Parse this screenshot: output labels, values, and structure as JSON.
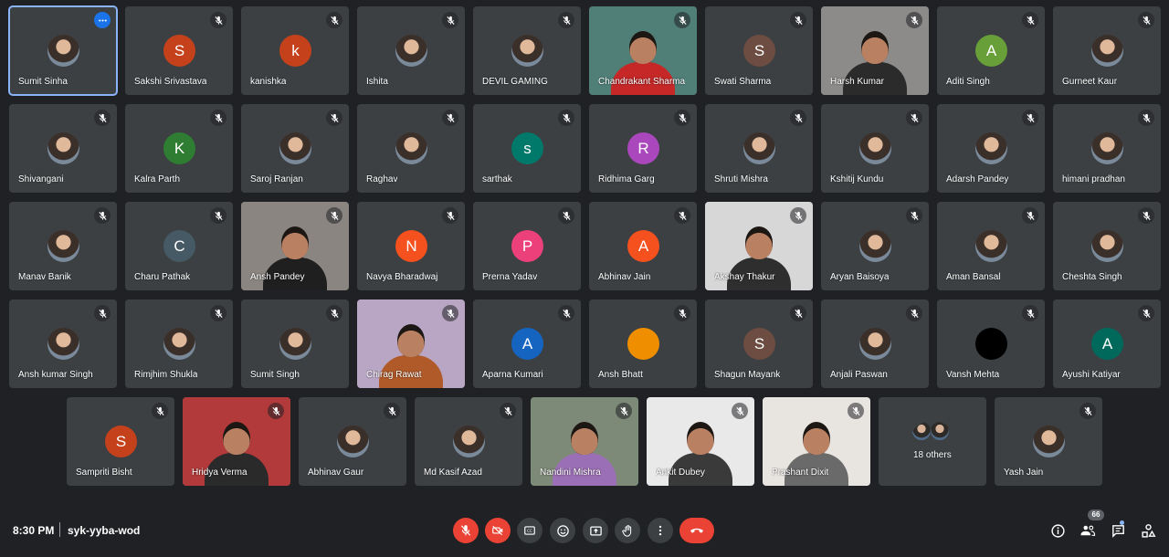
{
  "tiles": [
    {
      "name": "Sumit Sinha",
      "type": "photo",
      "active": true
    },
    {
      "name": "Sakshi Srivastava",
      "type": "letter",
      "letter": "S",
      "color": "#c5411b"
    },
    {
      "name": "kanishka",
      "type": "letter",
      "letter": "k",
      "color": "#c5411b"
    },
    {
      "name": "Ishita",
      "type": "photo"
    },
    {
      "name": "DEVIL GAMING",
      "type": "photo"
    },
    {
      "name": "Chandrakant Sharma",
      "type": "video",
      "bg": "#4f7f77",
      "shirt": "#c62828"
    },
    {
      "name": "Swati Sharma",
      "type": "letter",
      "letter": "S",
      "color": "#6d4c41"
    },
    {
      "name": "Harsh Kumar",
      "type": "video",
      "bg": "#8d8a8a",
      "shirt": "#2b2b2b"
    },
    {
      "name": "Aditi Singh",
      "type": "letter",
      "letter": "A",
      "color": "#689f38"
    },
    {
      "name": "Gurneet Kaur",
      "type": "photo"
    },
    {
      "name": "Shivangani",
      "type": "photo"
    },
    {
      "name": "Kalra Parth",
      "type": "letter",
      "letter": "K",
      "color": "#2e7d32"
    },
    {
      "name": "Saroj Ranjan",
      "type": "photo"
    },
    {
      "name": "Raghav",
      "type": "photo"
    },
    {
      "name": "sarthak",
      "type": "letter",
      "letter": "s",
      "color": "#00796b"
    },
    {
      "name": "Ridhima Garg",
      "type": "letter",
      "letter": "R",
      "color": "#ab47bc"
    },
    {
      "name": "Shruti Mishra",
      "type": "photo"
    },
    {
      "name": "Kshitij Kundu",
      "type": "photo"
    },
    {
      "name": "Adarsh Pandey",
      "type": "photo"
    },
    {
      "name": "himani pradhan",
      "type": "photo"
    },
    {
      "name": "Manav Banik",
      "type": "photo"
    },
    {
      "name": "Charu Pathak",
      "type": "letter",
      "letter": "C",
      "color": "#455a64"
    },
    {
      "name": "Ansh Pandey",
      "type": "video",
      "bg": "#8a8580",
      "shirt": "#1f1f1f"
    },
    {
      "name": "Navya Bharadwaj",
      "type": "letter",
      "letter": "N",
      "color": "#f4511e"
    },
    {
      "name": "Prerna Yadav",
      "type": "letter",
      "letter": "P",
      "color": "#ec407a"
    },
    {
      "name": "Abhinav Jain",
      "type": "letter",
      "letter": "A",
      "color": "#f4511e"
    },
    {
      "name": "Akshay Thakur",
      "type": "video",
      "bg": "#d7d7d7",
      "shirt": "#2e2e2e"
    },
    {
      "name": "Aryan Baisoya",
      "type": "photo"
    },
    {
      "name": "Aman Bansal",
      "type": "photo"
    },
    {
      "name": "Cheshta Singh",
      "type": "photo"
    },
    {
      "name": "Ansh kumar Singh",
      "type": "photo"
    },
    {
      "name": "Rimjhim Shukla",
      "type": "photo"
    },
    {
      "name": "Sumit Singh",
      "type": "photo"
    },
    {
      "name": "Chirag Rawat",
      "type": "video",
      "bg": "#b8a6c4",
      "shirt": "#b05a2a"
    },
    {
      "name": "Aparna Kumari",
      "type": "letter",
      "letter": "A",
      "color": "#1565c0"
    },
    {
      "name": "Ansh Bhatt",
      "type": "letter",
      "letter": "",
      "color": "#ef8f00"
    },
    {
      "name": "Shagun Mayank",
      "type": "letter",
      "letter": "S",
      "color": "#6d4c41"
    },
    {
      "name": "Anjali Paswan",
      "type": "photo"
    },
    {
      "name": "Vansh Mehta",
      "type": "letter",
      "letter": "",
      "color": "#000000"
    },
    {
      "name": "Ayushi Katiyar",
      "type": "letter",
      "letter": "A",
      "color": "#00695c"
    },
    {
      "name": "Sampriti Bisht",
      "type": "letter",
      "letter": "S",
      "color": "#c5411b"
    },
    {
      "name": "Hridya Verma",
      "type": "video",
      "bg": "#b23a3a",
      "shirt": "#2a2a2a"
    },
    {
      "name": "Abhinav Gaur",
      "type": "photo"
    },
    {
      "name": "Md Kasif Azad",
      "type": "photo"
    },
    {
      "name": "Nandini Mishra",
      "type": "video",
      "bg": "#7d8a78",
      "shirt": "#9b6fb5"
    },
    {
      "name": "Ankit Dubey",
      "type": "video",
      "bg": "#e9e9e9",
      "shirt": "#3a3a3a"
    },
    {
      "name": "Prashant Dixit",
      "type": "video",
      "bg": "#e8e4e0",
      "shirt": "#6a6a6a"
    },
    {
      "name": "18 others",
      "type": "others"
    },
    {
      "name": "Yash Jain",
      "type": "photo"
    }
  ],
  "meeting": {
    "time": "8:30 PM",
    "separator": "|",
    "code": "syk-yyba-wod"
  },
  "participants_count": "66",
  "icons": {
    "muted": "mic-off-icon",
    "more": "more-options-icon",
    "mic": "mic-off-icon",
    "cam": "camera-off-icon",
    "captions": "captions-icon",
    "emoji": "emoji-icon",
    "present": "present-screen-icon",
    "hand": "raise-hand-icon",
    "more_options": "more-vert-icon",
    "leave": "end-call-icon",
    "info": "info-icon",
    "people": "people-icon",
    "chat": "chat-icon",
    "activities": "activities-icon"
  },
  "colors": {
    "background": "#202124",
    "tile": "#3c4043",
    "danger": "#ea4335",
    "active_outline": "#8ab4f8"
  }
}
